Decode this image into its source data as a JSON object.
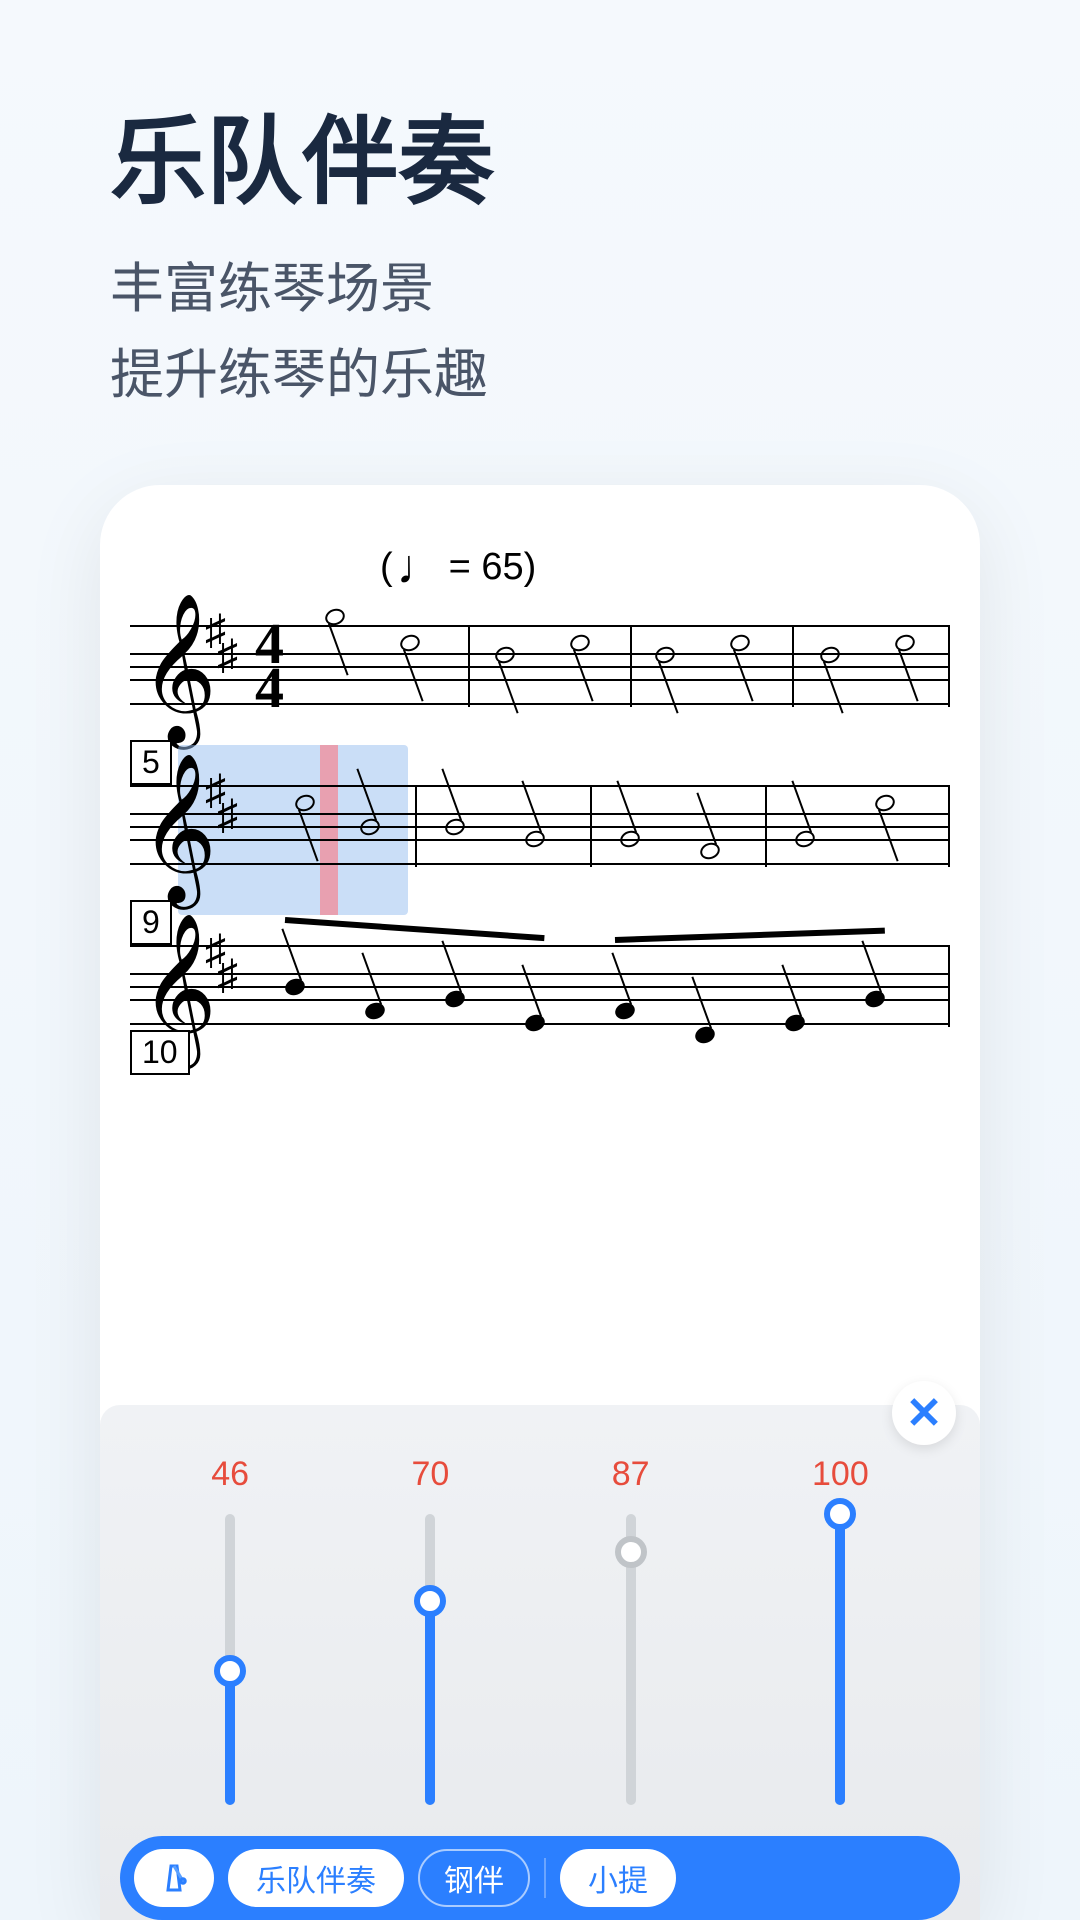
{
  "header": {
    "title": "乐队伴奏",
    "subtitle_line1": "丰富练琴场景",
    "subtitle_line2": "提升练琴的乐趣"
  },
  "score": {
    "tempo": "= 65)",
    "tempo_prefix": "(",
    "measure_numbers": [
      "5",
      "9",
      "10"
    ]
  },
  "mixer": {
    "close_label": "✕",
    "sliders": [
      {
        "value": "46",
        "percent": 46,
        "gray": false
      },
      {
        "value": "70",
        "percent": 70,
        "gray": false
      },
      {
        "value": "87",
        "percent": 87,
        "gray": true
      },
      {
        "value": "100",
        "percent": 100,
        "gray": false
      }
    ]
  },
  "bottombar": {
    "metronome_label": "节拍器",
    "accompaniment_label": "乐队伴奏",
    "piano_label": "钢伴",
    "violin_label": "小提"
  }
}
